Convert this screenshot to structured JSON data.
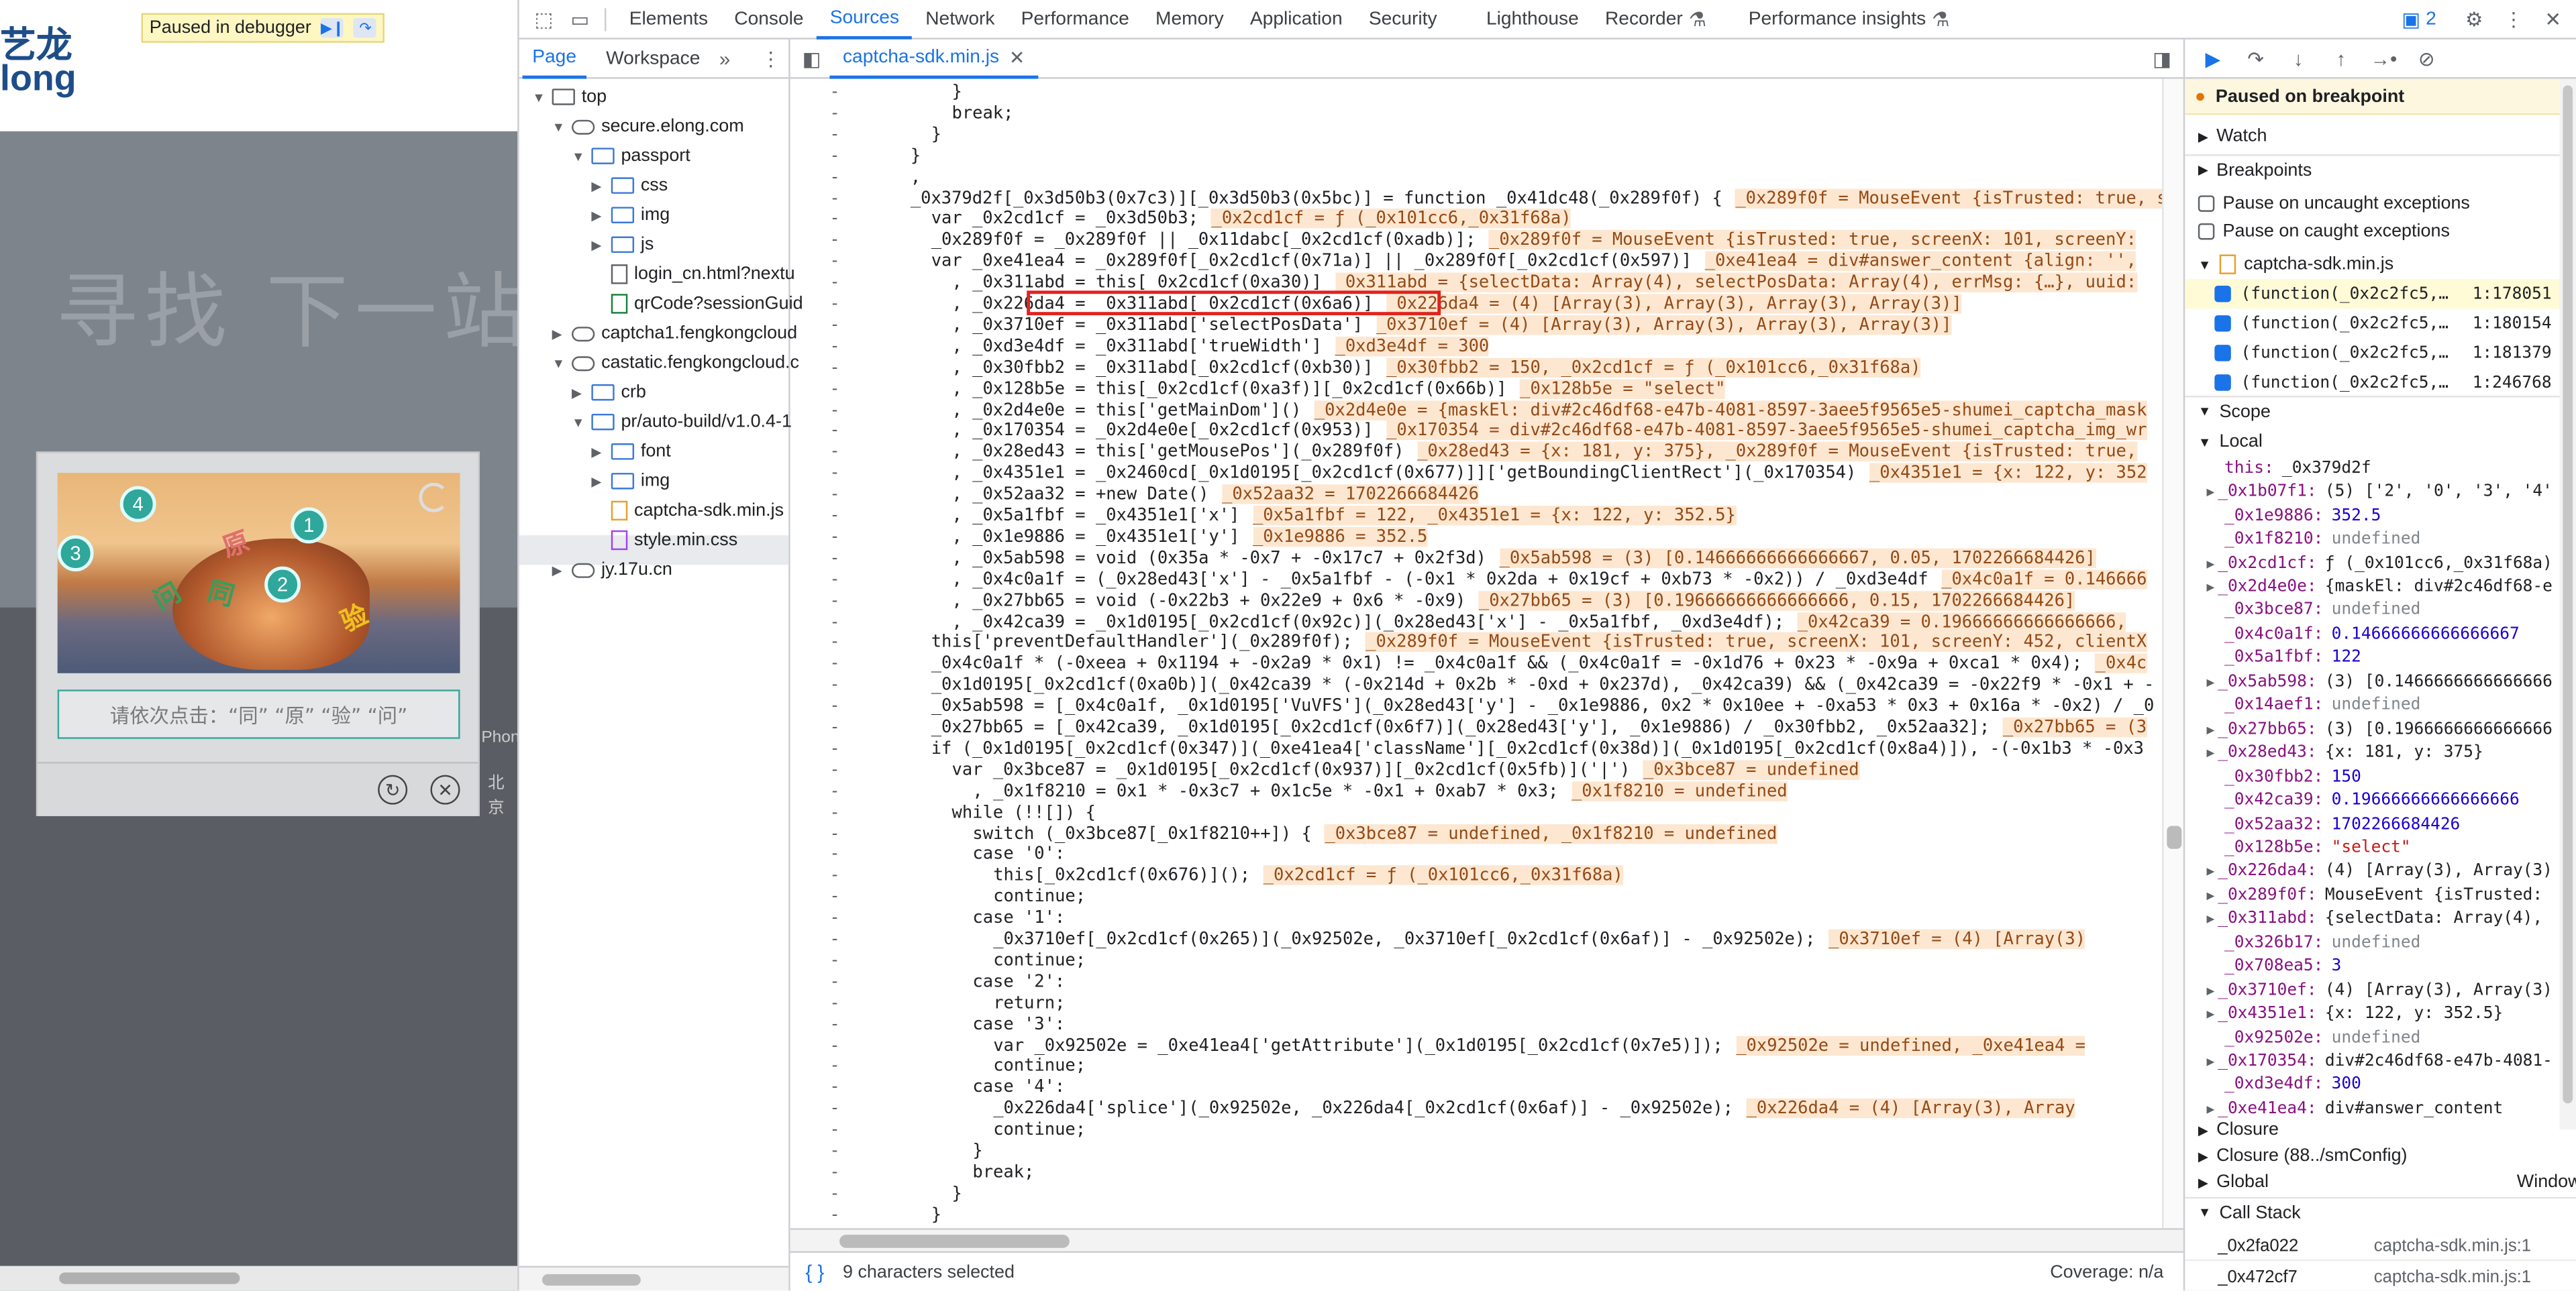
{
  "page": {
    "logo_text": "艺龙\nlong",
    "banner_text": "寻找 下一站",
    "debugger_pill": "Paused in debugger",
    "captcha": {
      "numbers": [
        "4",
        "1",
        "3",
        "2"
      ],
      "chars": [
        "原",
        "同",
        "问",
        "验"
      ],
      "instruction": "请依次点击：“同” “原” “验” “问”",
      "side_text_1": "Phon",
      "side_text_2": "北京"
    }
  },
  "devtools": {
    "tabs": [
      "Elements",
      "Console",
      "Sources",
      "Network",
      "Performance",
      "Memory",
      "Application",
      "Security",
      "Lighthouse",
      "Recorder",
      "Performance insights"
    ],
    "active_tab": "Sources",
    "issues_count": "2",
    "navigator": {
      "tabs": [
        "Page",
        "Workspace"
      ],
      "tree": [
        {
          "label": "top",
          "type": "frame",
          "depth": 0,
          "open": true
        },
        {
          "label": "secure.elong.com",
          "type": "cloud",
          "depth": 1,
          "open": true
        },
        {
          "label": "passport",
          "type": "folder",
          "depth": 2,
          "open": true
        },
        {
          "label": "css",
          "type": "folder",
          "depth": 3,
          "open": false
        },
        {
          "label": "img",
          "type": "folder",
          "depth": 3,
          "open": false
        },
        {
          "label": "js",
          "type": "folder",
          "depth": 3,
          "open": false
        },
        {
          "label": "login_cn.html?nextu",
          "type": "file",
          "depth": 3
        },
        {
          "label": "qrCode?sessionGuid",
          "type": "file-green",
          "depth": 3
        },
        {
          "label": "captcha1.fengkongcloud",
          "type": "cloud",
          "depth": 1,
          "open": false
        },
        {
          "label": "castatic.fengkongcloud.c",
          "type": "cloud",
          "depth": 1,
          "open": true
        },
        {
          "label": "crb",
          "type": "folder",
          "depth": 2,
          "open": false
        },
        {
          "label": "pr/auto-build/v1.0.4-1",
          "type": "folder",
          "depth": 2,
          "open": true
        },
        {
          "label": "font",
          "type": "folder",
          "depth": 3,
          "open": false
        },
        {
          "label": "img",
          "type": "folder",
          "depth": 3,
          "open": false
        },
        {
          "label": "captcha-sdk.min.js",
          "type": "file-js",
          "depth": 3,
          "selected": true
        },
        {
          "label": "style.min.css",
          "type": "file-css",
          "depth": 3
        },
        {
          "label": "jy.17u.cn",
          "type": "cloud",
          "depth": 1,
          "open": false
        }
      ]
    },
    "editor": {
      "file_tab": "captcha-sdk.min.js",
      "status_left": "9 characters selected",
      "status_right": "Coverage: n/a",
      "lines": [
        {
          "ind": 8,
          "code": "}",
          "inline": ""
        },
        {
          "ind": 8,
          "code": "break;",
          "inline": ""
        },
        {
          "ind": 6,
          "code": "}",
          "inline": ""
        },
        {
          "ind": 4,
          "code": "}",
          "inline": ""
        },
        {
          "ind": 4,
          "code": ",",
          "inline": ""
        },
        {
          "ind": 4,
          "code": "_0x379d2f[_0x3d50b3(0x7c3)][_0x3d50b3(0x5bc)] = function _0x41dc48(_0x289f0f) {",
          "inline": "_0x289f0f = MouseEvent {isTrusted: true, s"
        },
        {
          "ind": 6,
          "code": "var _0x2cd1cf = _0x3d50b3;",
          "inline": "_0x2cd1cf = ƒ (_0x101cc6,_0x31f68a)"
        },
        {
          "ind": 6,
          "code": "_0x289f0f = _0x289f0f || _0x11dabc[_0x2cd1cf(0xadb)];",
          "inline": "_0x289f0f = MouseEvent {isTrusted: true, screenX: 101, screenY:"
        },
        {
          "ind": 6,
          "code": "var _0xe41ea4 = _0x289f0f[_0x2cd1cf(0x71a)] || _0x289f0f[_0x2cd1cf(0x597)]",
          "inline": "_0xe41ea4 = div#answer_content {align: '',"
        },
        {
          "ind": 8,
          "code": ", _0x311abd = this[_0x2cd1cf(0xa30)]",
          "inline": "_0x311abd = {selectData: Array(4), selectPosData: Array(4), errMsg: {…}, uuid:"
        },
        {
          "ind": 8,
          "code": ", _0x226da4 = _0x311abd[_0x2cd1cf(0x6a6)]",
          "inline": "_0x226da4 = (4) [Array(3), Array(3), Array(3), Array(3)]"
        },
        {
          "ind": 8,
          "code": ", _0x3710ef = _0x311abd['selectPosData']",
          "inline": "_0x3710ef = (4) [Array(3), Array(3), Array(3), Array(3)]"
        },
        {
          "ind": 8,
          "code": ", _0xd3e4df = _0x311abd['trueWidth']",
          "inline": "_0xd3e4df = 300"
        },
        {
          "ind": 8,
          "code": ", _0x30fbb2 = _0x311abd[_0x2cd1cf(0xb30)]",
          "inline": "_0x30fbb2 = 150, _0x2cd1cf = ƒ (_0x101cc6,_0x31f68a)"
        },
        {
          "ind": 8,
          "code": ", _0x128b5e = this[_0x2cd1cf(0xa3f)][_0x2cd1cf(0x66b)]",
          "inline": "_0x128b5e = \"select\""
        },
        {
          "ind": 8,
          "code": ", _0x2d4e0e = this['getMainDom']()",
          "inline": "_0x2d4e0e = {maskEl: div#2c46df68-e47b-4081-8597-3aee5f9565e5-shumei_captcha_mask"
        },
        {
          "ind": 8,
          "code": ", _0x170354 = _0x2d4e0e[_0x2cd1cf(0x953)]",
          "inline": "_0x170354 = div#2c46df68-e47b-4081-8597-3aee5f9565e5-shumei_captcha_img_wr"
        },
        {
          "ind": 8,
          "code": ", _0x28ed43 = this['getMousePos'](_0x289f0f)",
          "inline": "_0x28ed43 = {x: 181, y: 375}, _0x289f0f = MouseEvent {isTrusted: true,"
        },
        {
          "ind": 8,
          "code": ", _0x4351e1 = _0x2460cd[_0x1d0195[_0x2cd1cf(0x677)]]['getBoundingClientRect'](_0x170354)",
          "inline": "_0x4351e1 = {x: 122, y: 352"
        },
        {
          "ind": 8,
          "code": ", _0x52aa32 = +new Date()",
          "inline": "_0x52aa32 = 1702266684426"
        },
        {
          "ind": 8,
          "code": ", _0x5a1fbf = _0x4351e1['x']",
          "inline": "_0x5a1fbf = 122, _0x4351e1 = {x: 122, y: 352.5}"
        },
        {
          "ind": 8,
          "code": ", _0x1e9886 = _0x4351e1['y']",
          "inline": "_0x1e9886 = 352.5"
        },
        {
          "ind": 8,
          "code": ", _0x5ab598 = void (0x35a * -0x7 + -0x17c7 + 0x2f3d)",
          "inline": "_0x5ab598 = (3) [0.14666666666666667, 0.05, 1702266684426]"
        },
        {
          "ind": 8,
          "code": ", _0x4c0a1f = (_0x28ed43['x'] - _0x5a1fbf - (-0x1 * 0x2da + 0x19cf + 0xb73 * -0x2)) / _0xd3e4df",
          "inline": "_0x4c0a1f = 0.146666"
        },
        {
          "ind": 8,
          "code": ", _0x27bb65 = void (-0x22b3 + 0x22e9 + 0x6 * -0x9)",
          "inline": "_0x27bb65 = (3) [0.19666666666666666, 0.15, 1702266684426]"
        },
        {
          "ind": 8,
          "code": ", _0x42ca39 = _0x1d0195[_0x2cd1cf(0x92c)](_0x28ed43['x'] - _0x5a1fbf, _0xd3e4df);",
          "inline": "_0x42ca39 = 0.19666666666666666,"
        },
        {
          "ind": 6,
          "code": "this['preventDefaultHandler'](_0x289f0f);",
          "inline": "_0x289f0f = MouseEvent {isTrusted: true, screenX: 101, screenY: 452, clientX"
        },
        {
          "ind": 6,
          "code": "_0x4c0a1f * (-0xeea + 0x1194 + -0x2a9 * 0x1) != _0x4c0a1f && (_0x4c0a1f = -0x1d76 + 0x23 * -0x9a + 0xca1 * 0x4);",
          "inline": "_0x4c"
        },
        {
          "ind": 6,
          "code": "_0x1d0195[_0x2cd1cf(0xa0b)](_0x42ca39 * (-0x214d + 0x2b * -0xd + 0x237d), _0x42ca39) && (_0x42ca39 = -0x22f9 * -0x1 + -",
          "inline": ""
        },
        {
          "ind": 6,
          "code": "_0x5ab598 = [_0x4c0a1f, _0x1d0195['VuVFS'](_0x28ed43['y'] - _0x1e9886, 0x2 * 0x10ee + -0xa53 * 0x3 + 0x16a * -0x2) / _0",
          "inline": ""
        },
        {
          "ind": 6,
          "code": "_0x27bb65 = [_0x42ca39, _0x1d0195[_0x2cd1cf(0x6f7)](_0x28ed43['y'], _0x1e9886) / _0x30fbb2, _0x52aa32];",
          "inline": "_0x27bb65 = (3"
        },
        {
          "ind": 6,
          "code": "if (_0x1d0195[_0x2cd1cf(0x347)](_0xe41ea4['className'][_0x2cd1cf(0x38d)](_0x1d0195[_0x2cd1cf(0x8a4)]), -(-0x1b3 * -0x3",
          "inline": ""
        },
        {
          "ind": 8,
          "code": "var _0x3bce87 = _0x1d0195[_0x2cd1cf(0x937)][_0x2cd1cf(0x5fb)]('|')",
          "inline": "_0x3bce87 = undefined"
        },
        {
          "ind": 10,
          "code": ", _0x1f8210 = 0x1 * -0x3c7 + 0x1c5e * -0x1 + 0xab7 * 0x3;",
          "inline": "_0x1f8210 = undefined"
        },
        {
          "ind": 8,
          "code": "while (!![]) {",
          "inline": ""
        },
        {
          "ind": 10,
          "code": "switch (_0x3bce87[_0x1f8210++]) {",
          "inline": "_0x3bce87 = undefined, _0x1f8210 = undefined"
        },
        {
          "ind": 10,
          "code": "case '0':",
          "inline": ""
        },
        {
          "ind": 12,
          "code": "this[_0x2cd1cf(0x676)]();",
          "inline": "_0x2cd1cf = ƒ (_0x101cc6,_0x31f68a)"
        },
        {
          "ind": 12,
          "code": "continue;",
          "inline": ""
        },
        {
          "ind": 10,
          "code": "case '1':",
          "inline": ""
        },
        {
          "ind": 12,
          "code": "_0x3710ef[_0x2cd1cf(0x265)](_0x92502e, _0x3710ef[_0x2cd1cf(0x6af)] - _0x92502e);",
          "inline": "_0x3710ef = (4) [Array(3)"
        },
        {
          "ind": 12,
          "code": "continue;",
          "inline": ""
        },
        {
          "ind": 10,
          "code": "case '2':",
          "inline": ""
        },
        {
          "ind": 12,
          "code": "return;",
          "inline": ""
        },
        {
          "ind": 10,
          "code": "case '3':",
          "inline": ""
        },
        {
          "ind": 12,
          "code": "var _0x92502e = _0xe41ea4['getAttribute'](_0x1d0195[_0x2cd1cf(0x7e5)]);",
          "inline": "_0x92502e = undefined, _0xe41ea4 ="
        },
        {
          "ind": 12,
          "code": "continue;",
          "inline": ""
        },
        {
          "ind": 10,
          "code": "case '4':",
          "inline": ""
        },
        {
          "ind": 12,
          "code": "_0x226da4['splice'](_0x92502e, _0x226da4[_0x2cd1cf(0x6af)] - _0x92502e);",
          "inline": "_0x226da4 = (4) [Array(3), Array"
        },
        {
          "ind": 12,
          "code": "continue;",
          "inline": ""
        },
        {
          "ind": 10,
          "code": "}",
          "inline": ""
        },
        {
          "ind": 10,
          "code": "break;",
          "inline": ""
        },
        {
          "ind": 8,
          "code": "}",
          "inline": ""
        },
        {
          "ind": 6,
          "code": "}",
          "inline": ""
        }
      ]
    },
    "sidebar": {
      "paused_text": "Paused on breakpoint",
      "watch": "Watch",
      "breakpoints": "Breakpoints",
      "pause_uncaught": "Pause on uncaught exceptions",
      "pause_caught": "Pause on caught exceptions",
      "bp_file": "captcha-sdk.min.js",
      "bp_items": [
        {
          "text": "(function(_0x2c2fc5,…",
          "loc": "1:178051"
        },
        {
          "text": "(function(_0x2c2fc5,…",
          "loc": "1:180154"
        },
        {
          "text": "(function(_0x2c2fc5,…",
          "loc": "1:181379"
        },
        {
          "text": "(function(_0x2c2fc5,…",
          "loc": "1:246768"
        }
      ],
      "scope": "Scope",
      "local": "Local",
      "scope_vars": [
        {
          "k": "this:",
          "v": "_0x379d2f",
          "t": "o",
          "exp": false
        },
        {
          "k": "_0x1b07f1:",
          "v": "(5) ['2', '0', '3', '4'",
          "t": "o",
          "exp": true
        },
        {
          "k": "_0x1e9886:",
          "v": "352.5",
          "t": "v",
          "exp": false
        },
        {
          "k": "_0x1f8210:",
          "v": "undefined",
          "t": "u",
          "exp": false
        },
        {
          "k": "_0x2cd1cf:",
          "v": "ƒ (_0x101cc6,_0x31f68a)",
          "t": "o",
          "exp": true
        },
        {
          "k": "_0x2d4e0e:",
          "v": "{maskEl: div#2c46df68-e",
          "t": "o",
          "exp": true
        },
        {
          "k": "_0x3bce87:",
          "v": "undefined",
          "t": "u",
          "exp": false
        },
        {
          "k": "_0x4c0a1f:",
          "v": "0.14666666666666667",
          "t": "v",
          "exp": false
        },
        {
          "k": "_0x5a1fbf:",
          "v": "122",
          "t": "v",
          "exp": false
        },
        {
          "k": "_0x5ab598:",
          "v": "(3) [0.1466666666666666",
          "t": "o",
          "exp": true
        },
        {
          "k": "_0x14aef1:",
          "v": "undefined",
          "t": "u",
          "exp": false
        },
        {
          "k": "_0x27bb65:",
          "v": "(3) [0.1966666666666666",
          "t": "o",
          "exp": true
        },
        {
          "k": "_0x28ed43:",
          "v": "{x: 181, y: 375}",
          "t": "o",
          "exp": true
        },
        {
          "k": "_0x30fbb2:",
          "v": "150",
          "t": "v",
          "exp": false
        },
        {
          "k": "_0x42ca39:",
          "v": "0.19666666666666666",
          "t": "v",
          "exp": false
        },
        {
          "k": "_0x52aa32:",
          "v": "1702266684426",
          "t": "v",
          "exp": false
        },
        {
          "k": "_0x128b5e:",
          "v": "\"select\"",
          "t": "s",
          "exp": false
        },
        {
          "k": "_0x226da4:",
          "v": "(4) [Array(3), Array(3)",
          "t": "o",
          "exp": true
        },
        {
          "k": "_0x289f0f:",
          "v": "MouseEvent {isTrusted:",
          "t": "o",
          "exp": true
        },
        {
          "k": "_0x311abd:",
          "v": "{selectData: Array(4),",
          "t": "o",
          "exp": true
        },
        {
          "k": "_0x326b17:",
          "v": "undefined",
          "t": "u",
          "exp": false
        },
        {
          "k": "_0x708ea5:",
          "v": "3",
          "t": "v",
          "exp": false
        },
        {
          "k": "_0x3710ef:",
          "v": "(4) [Array(3), Array(3)",
          "t": "o",
          "exp": true
        },
        {
          "k": "_0x4351e1:",
          "v": "{x: 122, y: 352.5}",
          "t": "o",
          "exp": true
        },
        {
          "k": "_0x92502e:",
          "v": "undefined",
          "t": "u",
          "exp": false
        },
        {
          "k": "_0x170354:",
          "v": "div#2c46df68-e47b-4081-",
          "t": "o",
          "exp": true
        },
        {
          "k": "_0xd3e4df:",
          "v": "300",
          "t": "v",
          "exp": false
        },
        {
          "k": "_0xe41ea4:",
          "v": "div#answer_content",
          "t": "o",
          "exp": true
        }
      ],
      "closure": "Closure",
      "closure2": "Closure (88../smConfig)",
      "global": "Global",
      "global_val": "Window",
      "callstack": "Call Stack",
      "frames": [
        {
          "f": "_0x2fa022",
          "l": "captcha-sdk.min.js:1"
        },
        {
          "f": "_0x472cf7",
          "l": "captcha-sdk.min.js:1"
        }
      ]
    }
  }
}
